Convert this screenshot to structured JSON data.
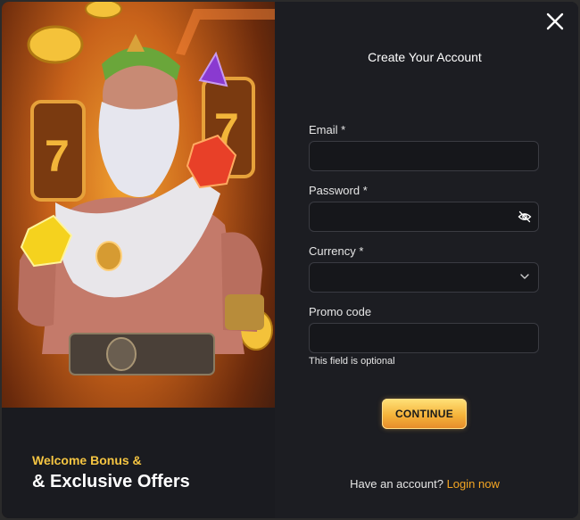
{
  "promo": {
    "subtitle": "Welcome Bonus &",
    "title": "& Exclusive Offers"
  },
  "form": {
    "title": "Create Your Account",
    "email_label": "Email *",
    "email_value": "",
    "password_label": "Password *",
    "password_value": "",
    "currency_label": "Currency *",
    "currency_value": "",
    "promo_label": "Promo code",
    "promo_value": "",
    "promo_hint": "This field is optional",
    "continue_label": "CONTINUE",
    "login_prompt": "Have an account?",
    "login_link": "Login now"
  },
  "icons": {
    "close": "close-icon",
    "password_toggle": "eye-slash-icon",
    "currency_dropdown": "chevron-down-icon"
  },
  "colors": {
    "accent": "#f5a623",
    "promo_subtitle": "#f5c542",
    "modal_bg": "#1c1d22"
  }
}
